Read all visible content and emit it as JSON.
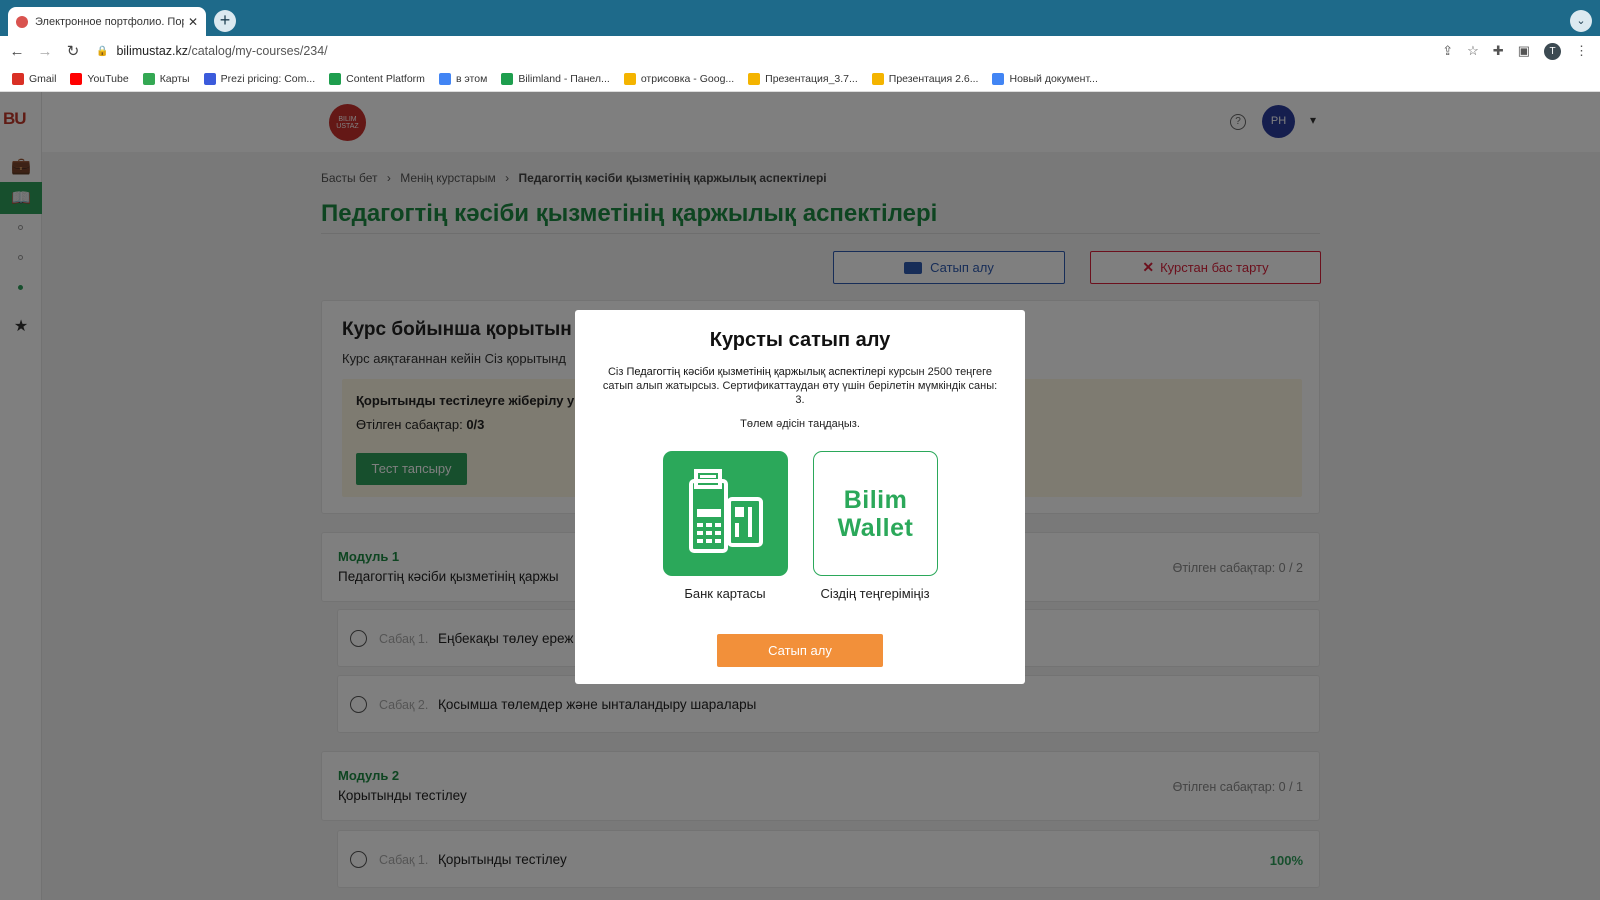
{
  "browser": {
    "tab_title": "Электронное портфолио. Пор",
    "new_tab": "+",
    "tab_menu": "⌄",
    "url_domain": "bilimustaz.kz",
    "url_path": "/catalog/my-courses/234/",
    "profile_initial": "T",
    "bookmarks": [
      {
        "label": "Gmail",
        "color": "#d93025"
      },
      {
        "label": "YouTube",
        "color": "#ff0000"
      },
      {
        "label": "Карты",
        "color": "#34a853"
      },
      {
        "label": "Prezi pricing: Com...",
        "color": "#3b5bdb"
      },
      {
        "label": "Content Platform",
        "color": "#1e9e4e"
      },
      {
        "label": "в этом",
        "color": "#4285f4"
      },
      {
        "label": "Bilimland - Панел...",
        "color": "#1e9e4e"
      },
      {
        "label": "отрисовка - Goog...",
        "color": "#f4b400"
      },
      {
        "label": "Презентация_3.7...",
        "color": "#f4b400"
      },
      {
        "label": "Презентация 2.6...",
        "color": "#f4b400"
      },
      {
        "label": "Новый документ...",
        "color": "#4285f4"
      }
    ]
  },
  "sidebar": {
    "logo": "BU",
    "chevron": "›"
  },
  "header": {
    "brand": "BILIM USTAZ",
    "help": "?",
    "avatar": "PH",
    "caret": "▾"
  },
  "breadcrumb": {
    "home": "Басты бет",
    "sep": "›",
    "my_courses": "Менің курстарым",
    "current": "Педагогтің кәсіби қызметінің қаржылық аспектілері"
  },
  "page_title": "Педагогтің кәсіби қызметінің қаржылық аспектілері",
  "actions": {
    "buy": "Сатып алу",
    "cancel": "Курстан бас тарту"
  },
  "summary": {
    "title": "Курс бойынша қорытын",
    "subtitle": "Курс аяқтағаннан кейін Сіз қорытынд",
    "inner_title": "Қорытынды тестілеуге жіберілу у",
    "done_label": "Өтілген сабақтар:",
    "done_value": "0/3",
    "test_button": "Тест тапсыру"
  },
  "modules": [
    {
      "title": "Модуль 1",
      "name": "Педагогтің кәсіби қызметінің қаржы",
      "progress": "Өтілген сабақтар: 0 / 2",
      "lessons": [
        {
          "num": "Сабақ 1.",
          "title": "Еңбекақы төлеу ереж",
          "pct": ""
        },
        {
          "num": "Сабақ 2.",
          "title": "Қосымша төлемдер және ынталандыру шаралары",
          "pct": ""
        }
      ]
    },
    {
      "title": "Модуль 2",
      "name": "Қорытынды тестілеу",
      "progress": "Өтілген сабақтар: 0 / 1",
      "lessons": [
        {
          "num": "Сабақ 1.",
          "title": "Қорытынды тестілеу",
          "pct": "100%"
        }
      ]
    }
  ],
  "modal": {
    "title": "Курсты сатып алу",
    "desc_prefix": "Сіз",
    "desc_course": "Педагогтің кәсіби қызметінің қаржылық аспектілері",
    "desc_suffix": "курсын  2500 теңгеге сатып алып жатырсыз. Сертификаттаудан өту үшін берілетін мүмкіндік саны: 3.",
    "choose": "Төлем әдісін таңдаңыз.",
    "bank_label": "Банк картасы",
    "wallet_line1": "Bilim",
    "wallet_line2": "Wallet",
    "wallet_label": "Сіздің теңгеріміңіз",
    "buy_button": "Сатып алу"
  },
  "colors": {
    "primary_green": "#1c8a43",
    "accent_orange": "#f2903a",
    "danger_red": "#d9213a",
    "link_blue": "#2e5ab0"
  }
}
